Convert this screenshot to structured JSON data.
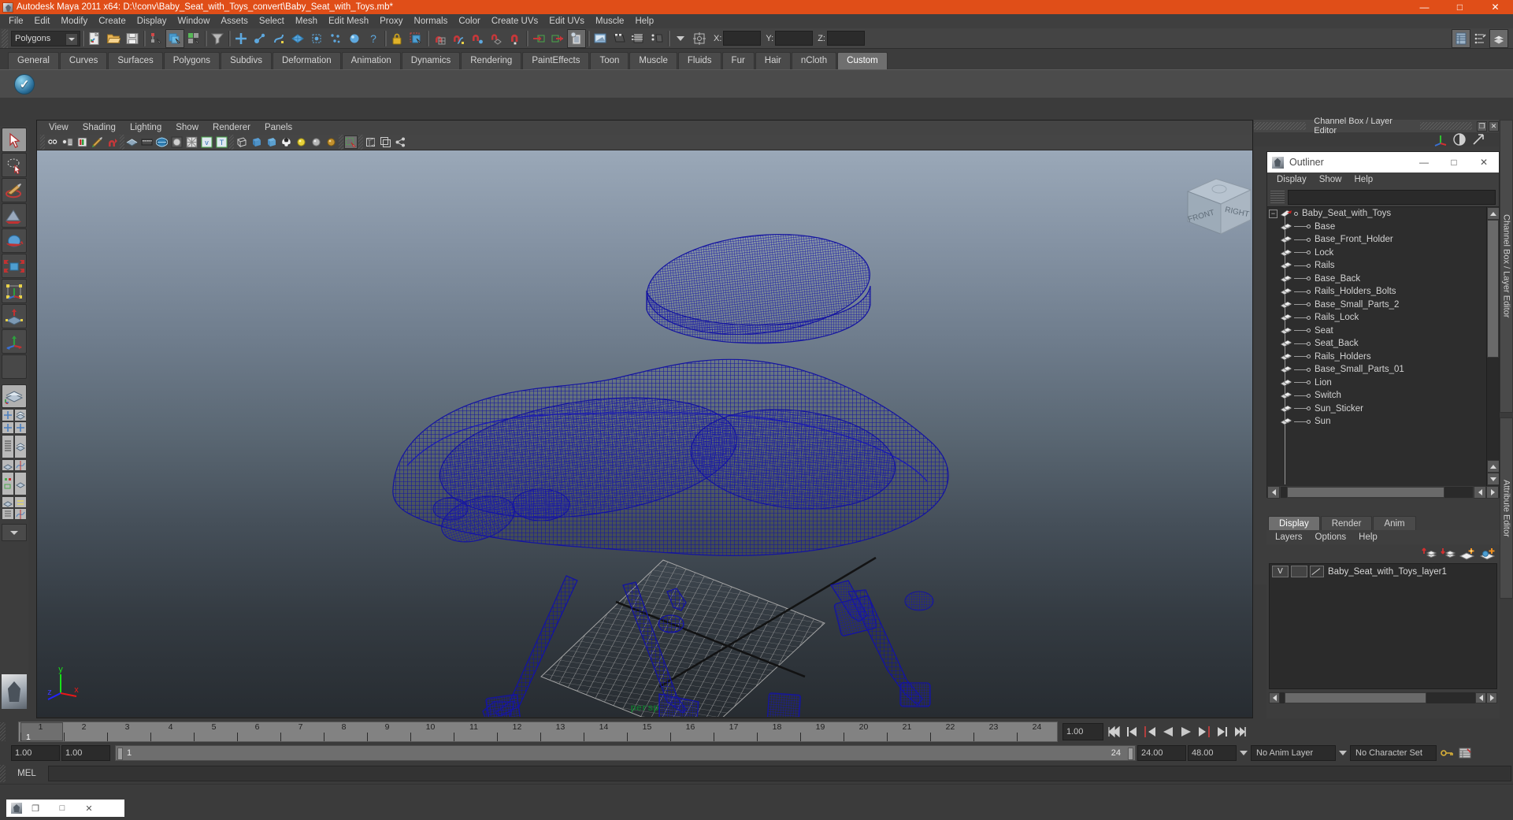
{
  "window": {
    "title": "Autodesk Maya 2011 x64: D:\\!conv\\Baby_Seat_with_Toys_convert\\Baby_Seat_with_Toys.mb*",
    "app_icon": "maya-icon",
    "minimize": "—",
    "maximize": "□",
    "close": "✕"
  },
  "menubar": {
    "items": [
      "File",
      "Edit",
      "Modify",
      "Create",
      "Display",
      "Window",
      "Assets",
      "Select",
      "Mesh",
      "Edit Mesh",
      "Proxy",
      "Normals",
      "Color",
      "Create UVs",
      "Edit UVs",
      "Muscle",
      "Help"
    ]
  },
  "statusline": {
    "selection_mode": "Polygons",
    "coord_labels": {
      "x": "X:",
      "y": "Y:",
      "z": "Z:"
    },
    "coord_values": {
      "x": "",
      "y": "",
      "z": ""
    },
    "icons": [
      "new-scene-icon",
      "open-scene-icon",
      "save-scene-icon",
      "select-by-hierarchy-icon",
      "select-by-object-icon",
      "select-by-component-icon",
      "mask-filter-icon",
      "handles-icon",
      "joints-icon",
      "curves-icon",
      "surfaces-icon",
      "deformers-icon",
      "dynamics-icon",
      "rendering-icon",
      "misc-icon",
      "lock-icon",
      "highlight-selection-icon",
      "snap-to-grid-icon",
      "snap-to-curve-icon",
      "snap-to-point-icon",
      "snap-to-projected-center-icon",
      "snap-to-view-plane-icon",
      "make-live-icon",
      "input-connections-icon",
      "output-connections-icon",
      "construction-history-icon",
      "render-current-frame-icon",
      "ipr-render-icon",
      "render-settings-icon",
      "hypershade-icon",
      "render-view-icon",
      "absolute-relative-icon",
      "show-hide-channel-box-icon",
      "show-hide-attribute-editor-icon",
      "show-hide-tool-settings-icon"
    ]
  },
  "shelf": {
    "tabs": [
      "General",
      "Curves",
      "Surfaces",
      "Polygons",
      "Subdivs",
      "Deformation",
      "Animation",
      "Dynamics",
      "Rendering",
      "PaintEffects",
      "Toon",
      "Muscle",
      "Fluids",
      "Fur",
      "Hair",
      "nCloth",
      "Custom"
    ],
    "active_tab": "Custom",
    "buttons": [
      "custom-script-button"
    ]
  },
  "toolbox": {
    "items": [
      {
        "name": "select-tool",
        "selected": true
      },
      {
        "name": "lasso-select-tool",
        "selected": false
      },
      {
        "name": "paint-select-tool",
        "selected": false
      },
      {
        "name": "move-tool",
        "selected": false
      },
      {
        "name": "rotate-tool",
        "selected": false
      },
      {
        "name": "scale-tool",
        "selected": false
      },
      {
        "name": "universal-manipulator-tool",
        "selected": false
      },
      {
        "name": "soft-modification-tool",
        "selected": false
      },
      {
        "name": "show-manipulator-tool",
        "selected": false
      },
      {
        "name": "last-tool-used",
        "selected": false
      }
    ],
    "layouts": [
      {
        "name": "single-perspective-layout"
      },
      {
        "name": "four-view-layout"
      },
      {
        "name": "outliner-persp-layout"
      },
      {
        "name": "persp-graph-layout"
      },
      {
        "name": "hypershade-persp-layout"
      },
      {
        "name": "persp-graph-outliner-layout"
      },
      {
        "name": "layout-more-chevron"
      }
    ]
  },
  "viewport": {
    "menus": [
      "View",
      "Shading",
      "Lighting",
      "Show",
      "Renderer",
      "Panels"
    ],
    "toolbar_icons": [
      "select-camera-icon",
      "camera-attributes-icon",
      "book-icon",
      "paint-icon",
      "toggle-icon",
      "smooth-shade-icon",
      "film-gate-icon",
      "resolution-gate-icon",
      "gate-mask-icon",
      "field-chart-icon",
      "safe-action-icon",
      "safe-title-icon",
      "wireframe-icon",
      "smooth-shade-all-icon",
      "flat-shade-icon",
      "shaded-textured-icon",
      "use-default-light-icon",
      "use-all-lights-icon",
      "shadows-icon",
      "xray-icon",
      "isolate-select-icon",
      "exposure-icon",
      "gamma-icon"
    ],
    "camera_label": "persp",
    "axis": {
      "x": "x",
      "y": "y",
      "z": "z"
    },
    "viewcube": {
      "front": "FRONT",
      "right": "RIGHT"
    },
    "model_color": "#1414a0",
    "grid_color": "#a8a8a8"
  },
  "right_dock": {
    "title": "Channel Box / Layer Editor",
    "restore": "❐",
    "close": "✕",
    "icons": [
      "axis-icon",
      "contrast-icon",
      "arrow-icon"
    ],
    "vertical_tabs": [
      "Channel Box / Layer Editor",
      "Attribute Editor"
    ]
  },
  "outliner": {
    "title": "Outliner",
    "minimize": "—",
    "maximize": "□",
    "close": "✕",
    "menus": [
      "Display",
      "Show",
      "Help"
    ],
    "search_value": "",
    "search_placeholder": "",
    "root": {
      "label": "Baby_Seat_with_Toys",
      "expanded": true,
      "icon": "transform-icon"
    },
    "items": [
      {
        "label": "Base",
        "icon": "mesh-icon"
      },
      {
        "label": "Base_Front_Holder",
        "icon": "mesh-icon"
      },
      {
        "label": "Lock",
        "icon": "mesh-icon"
      },
      {
        "label": "Rails",
        "icon": "mesh-icon"
      },
      {
        "label": "Base_Back",
        "icon": "mesh-icon"
      },
      {
        "label": "Rails_Holders_Bolts",
        "icon": "mesh-icon"
      },
      {
        "label": "Base_Small_Parts_2",
        "icon": "mesh-icon"
      },
      {
        "label": "Rails_Lock",
        "icon": "mesh-icon"
      },
      {
        "label": "Seat",
        "icon": "mesh-icon"
      },
      {
        "label": "Seat_Back",
        "icon": "mesh-icon"
      },
      {
        "label": "Rails_Holders",
        "icon": "mesh-icon"
      },
      {
        "label": "Base_Small_Parts_01",
        "icon": "mesh-icon"
      },
      {
        "label": "Lion",
        "icon": "mesh-icon"
      },
      {
        "label": "Switch",
        "icon": "mesh-icon"
      },
      {
        "label": "Sun_Sticker",
        "icon": "mesh-icon"
      },
      {
        "label": "Sun",
        "icon": "mesh-icon"
      }
    ]
  },
  "layer_editor": {
    "tabs": [
      "Display",
      "Render",
      "Anim"
    ],
    "active_tab": "Display",
    "menus": [
      "Layers",
      "Options",
      "Help"
    ],
    "tool_icons": [
      "move-layer-up-icon",
      "move-layer-down-icon",
      "new-layer-icon",
      "new-layer-from-selected-icon"
    ],
    "layers": [
      {
        "visibility": "V",
        "state": "",
        "name": "Baby_Seat_with_Toys_layer1"
      }
    ]
  },
  "timeslider": {
    "ticks": [
      "1",
      "2",
      "3",
      "4",
      "5",
      "6",
      "7",
      "8",
      "9",
      "10",
      "11",
      "12",
      "13",
      "14",
      "15",
      "16",
      "17",
      "18",
      "19",
      "20",
      "21",
      "22",
      "23",
      "24"
    ],
    "current_frame_label": "1",
    "current_frame_field": "1.00",
    "playback_buttons": [
      "go-to-start-icon",
      "step-back-keyframe-icon",
      "step-back-frame-icon",
      "play-backwards-icon",
      "play-forwards-icon",
      "step-forward-frame-icon",
      "step-forward-keyframe-icon",
      "go-to-end-icon"
    ]
  },
  "rangeslider": {
    "anim_start": "1.00",
    "range_start": "1.00",
    "range_start_label": "1",
    "range_end_label": "24",
    "range_end": "24.00",
    "anim_end": "48.00",
    "anim_layer": "No Anim Layer",
    "character_set": "No Character Set",
    "key_icon": "auto-keyframe-icon",
    "prefs_icon": "animation-preferences-icon"
  },
  "command_line": {
    "label": "MEL",
    "value": "",
    "placeholder": ""
  },
  "taskbar": {
    "window_icon": "maya-icon",
    "restore": "❐",
    "maximize": "□",
    "close": "✕"
  },
  "colors": {
    "title_bar": "#e04e18",
    "chrome": "#3b3b3b",
    "toolbar": "#444444",
    "accent": "#5285a8",
    "model_wire": "#1414a0",
    "persp_label": "#14702f"
  }
}
